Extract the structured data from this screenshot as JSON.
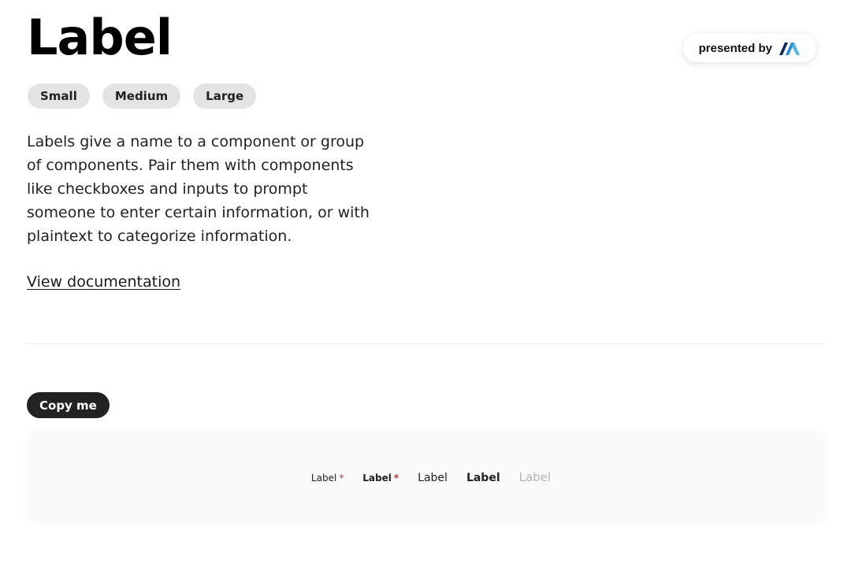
{
  "header": {
    "title": "Label",
    "presented_by": "presented by",
    "brand_icon": "brand-logo-icon"
  },
  "sizes": [
    "Small",
    "Medium",
    "Large"
  ],
  "description": "Labels give a name to a component or group of components. Pair them with components like checkboxes and inputs to prompt someone to enter certain information, or with plaintext to categorize information.",
  "doc_link": "View documentation",
  "copy_button": "Copy me",
  "demo": {
    "labels": [
      {
        "text": "Label",
        "required_mark": "*",
        "variant": "small-required"
      },
      {
        "text": "Label",
        "required_mark": "*",
        "variant": "small-strong-required"
      },
      {
        "text": "Label",
        "variant": "medium"
      },
      {
        "text": "Label",
        "variant": "medium-strong"
      },
      {
        "text": "Label",
        "variant": "disabled"
      }
    ]
  },
  "colors": {
    "accent_dark": "#222222",
    "required": "#c03030",
    "tag_bg": "#e4e4e4",
    "disabled_text": "#b5b5b5",
    "brand_blue": "#1f8fe0",
    "brand_navy": "#0b2a5a"
  }
}
